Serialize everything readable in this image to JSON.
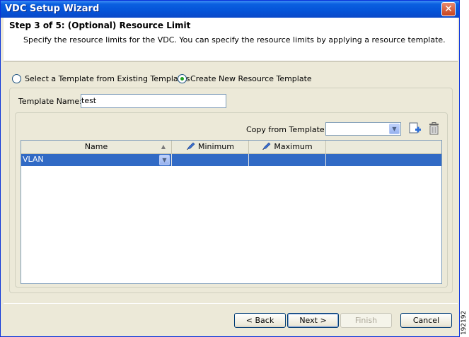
{
  "window": {
    "title": "VDC Setup Wizard",
    "close_glyph": "✕"
  },
  "header": {
    "step_title": "Step 3 of 5: (Optional) Resource Limit",
    "description": "Specify the resource limits for the VDC. You can specify the resource limits by applying a resource template."
  },
  "options": {
    "existing_label": "Select a Template from Existing Templates",
    "new_label": "Create New Resource Template",
    "selected": "new"
  },
  "template_name": {
    "label": "Template Name:",
    "value": "test"
  },
  "copy_from": {
    "label": "Copy from Template:",
    "value": ""
  },
  "table": {
    "columns": [
      "Name",
      "Minimum",
      "Maximum",
      ""
    ],
    "rows": [
      {
        "name": "VLAN",
        "minimum": "",
        "maximum": ""
      }
    ]
  },
  "buttons": {
    "back": "< Back",
    "next": "Next >",
    "finish": "Finish",
    "cancel": "Cancel"
  },
  "figure_id": "192192",
  "icons": {
    "sort": "sort-ascending-icon",
    "column_edit": "pencil-icon",
    "add": "add-template-icon",
    "delete": "trash-icon"
  },
  "colors": {
    "titlebar": "#0554d8",
    "selection": "#316ac5",
    "window_bg": "#ece9d8"
  }
}
